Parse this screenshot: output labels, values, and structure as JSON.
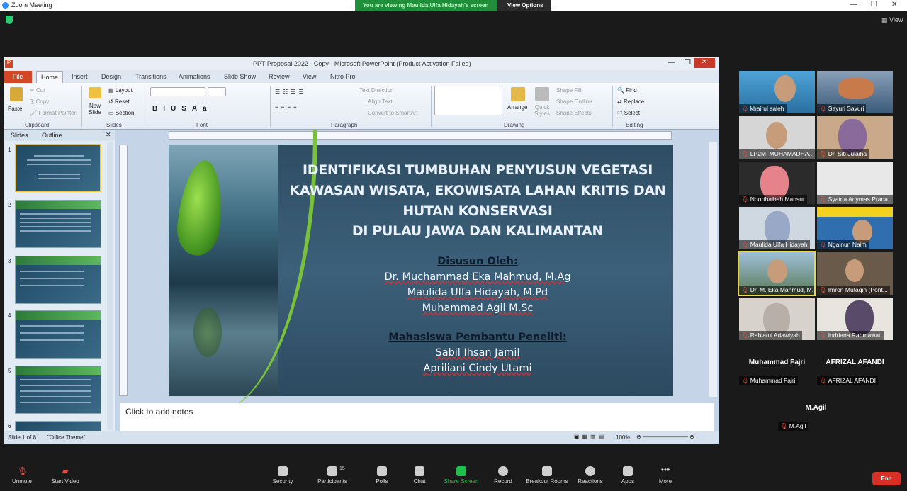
{
  "zoom": {
    "title": "Zoom Meeting",
    "banner": "You are viewing Maulida Ulfa Hidayah's screen",
    "view_options": "View Options",
    "view": "View"
  },
  "ppt": {
    "title": "PPT Proposal 2022 - Copy - Microsoft PowerPoint (Product Activation Failed)",
    "tabs": [
      "File",
      "Home",
      "Insert",
      "Design",
      "Transitions",
      "Animations",
      "Slide Show",
      "Review",
      "View",
      "Nitro Pro"
    ],
    "ribbon": {
      "paste": "Paste",
      "cut": "Cut",
      "copy": "Copy",
      "format_painter": "Format Painter",
      "clipboard": "Clipboard",
      "new_slide": "New Slide",
      "layout": "Layout",
      "reset": "Reset",
      "section": "Section",
      "slides": "Slides",
      "font": "Font",
      "paragraph": "Paragraph",
      "text_direction": "Text Direction",
      "align_text": "Align Text",
      "convert_smartart": "Convert to SmartArt",
      "arrange": "Arrange",
      "quick_styles": "Quick Styles",
      "shape_fill": "Shape Fill",
      "shape_outline": "Shape Outline",
      "shape_effects": "Shape Effects",
      "drawing": "Drawing",
      "find": "Find",
      "replace": "Replace",
      "select": "Select",
      "editing": "Editing"
    },
    "panel_tabs": [
      "Slides",
      "Outline"
    ],
    "slide_numbers": [
      "1",
      "2",
      "3",
      "4",
      "5",
      "6"
    ],
    "slide": {
      "title_lines": [
        "IDENTIFIKASI TUMBUHAN PENYUSUN VEGETASI",
        "KAWASAN WISATA, EKOWISATA LAHAN KRITIS DAN",
        "HUTAN KONSERVASI",
        "DI PULAU JAWA DAN KALIMANTAN"
      ],
      "disusun": "Disusun Oleh:",
      "authors": [
        "Dr. Muchammad Eka Mahmud, M.Ag",
        "Maulida Ulfa Hidayah, M.Pd",
        "Muhammad Agil M.Sc"
      ],
      "mahasiswa": "Mahasiswa Pembantu Peneliti:",
      "students": [
        "Sabil Ihsan Jamil",
        "Apriliani Cindy Utami"
      ]
    },
    "notes": "Click to add notes",
    "status": {
      "slide": "Slide 1 of 8",
      "theme": "\"Office Theme\"",
      "zoom": "100%"
    }
  },
  "participants": [
    "khairul saleh",
    "Sayuri Sayuri",
    "LP2M_MUHAMADHA...",
    "Dr. Siti Julaiha",
    "Noorthaibah Mansur",
    "Syatria Adymas Prana...",
    "Maulida Ulfa Hidayah",
    "Ngainun Naim",
    "Dr. M. Eka Mahmud, M...",
    "Imron Mutaqin (Pont...",
    "Rabiatul Adawiyah",
    "Indriana Rahmawati",
    "Muhammad Fajri",
    "AFRIZAL AFANDI",
    "M.Agil"
  ],
  "toolbar": {
    "unmute": "Unmute",
    "start_video": "Start Video",
    "security": "Security",
    "participants": "Participants",
    "participants_count": "15",
    "polls": "Polls",
    "chat": "Chat",
    "share_screen": "Share Screen",
    "record": "Record",
    "breakout": "Breakout Rooms",
    "reactions": "Reactions",
    "apps": "Apps",
    "more": "More",
    "end": "End"
  },
  "colors": {
    "share_green": "#1f8f3a",
    "end_red": "#d93025",
    "ppt_orange": "#d24726",
    "active_border": "#e8d64a"
  }
}
